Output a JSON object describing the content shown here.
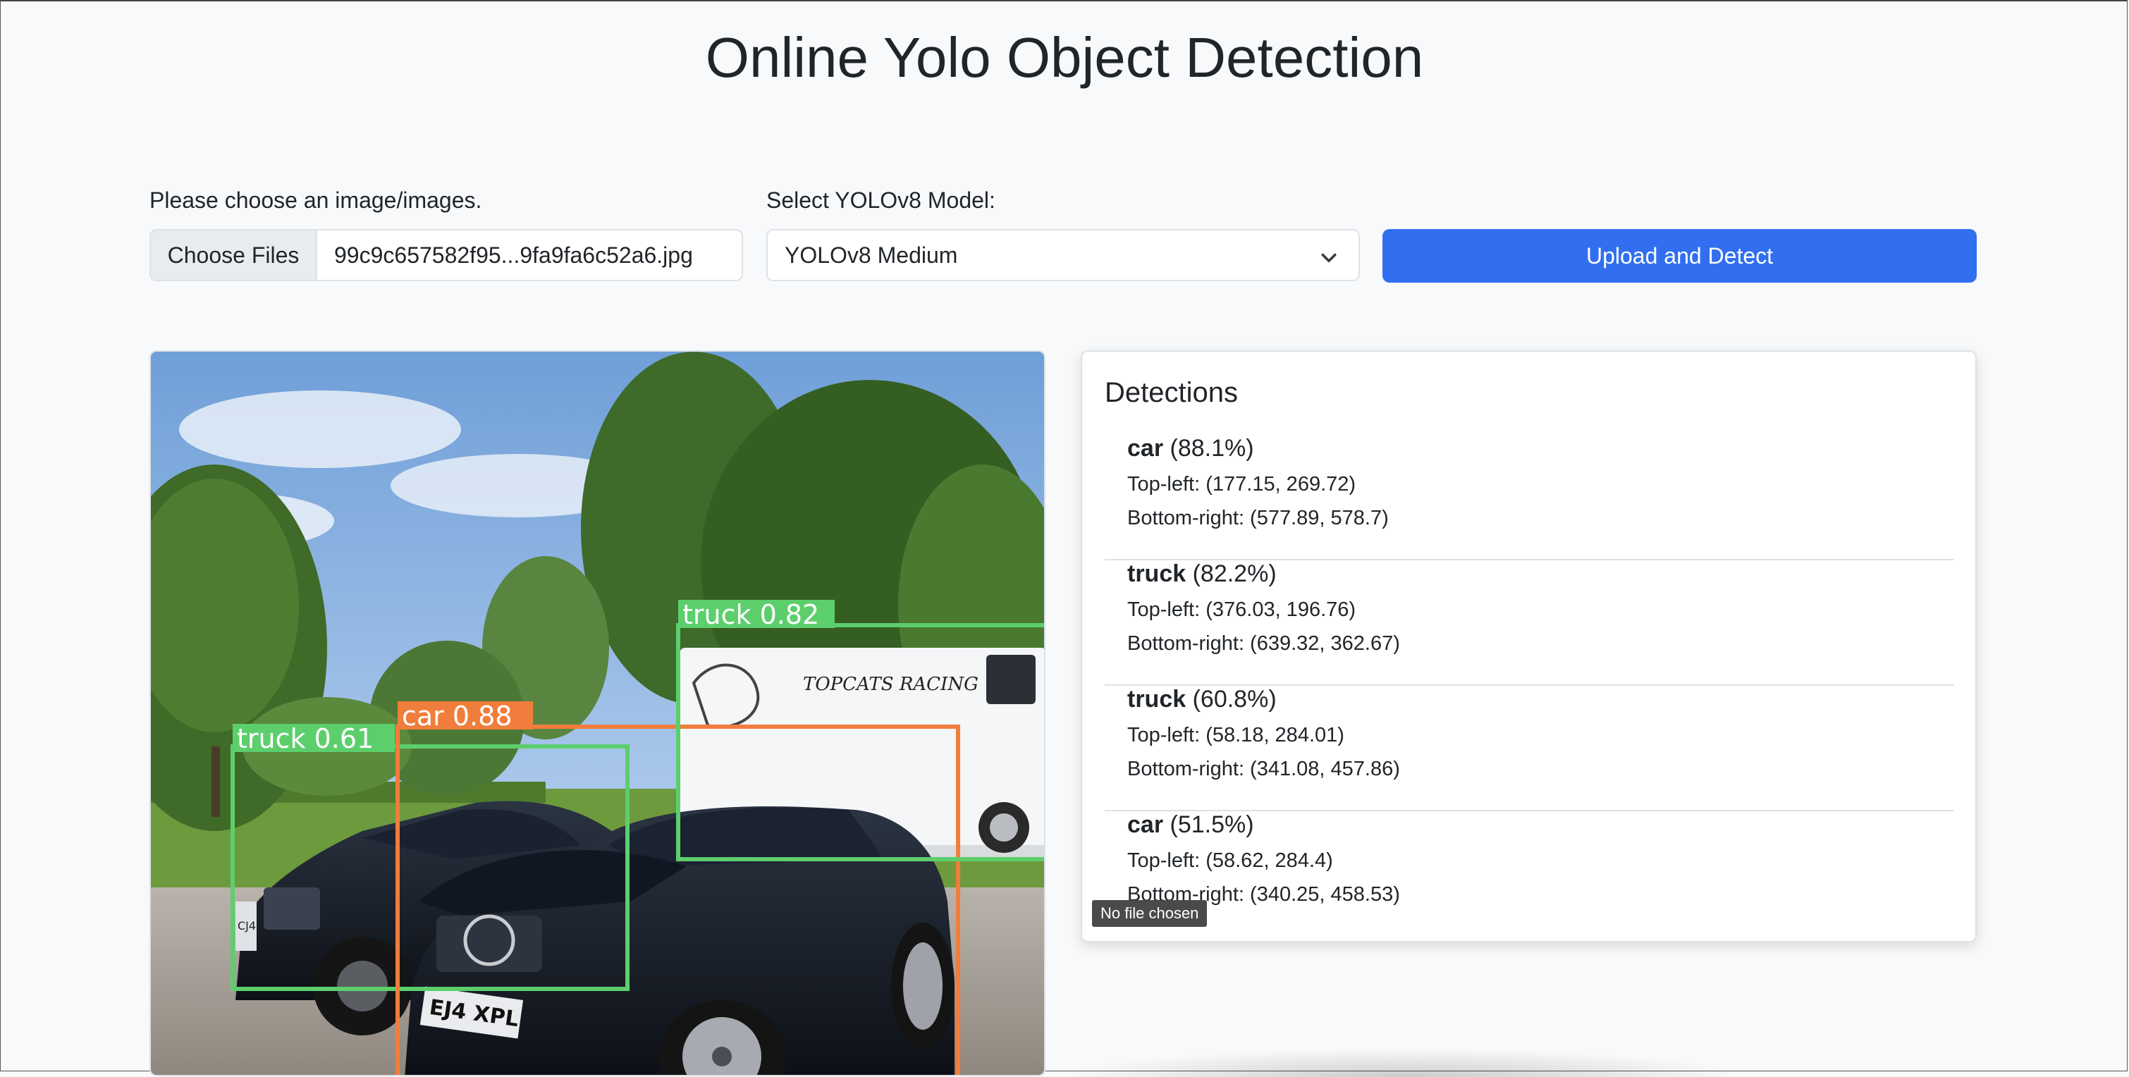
{
  "page": {
    "title": "Online Yolo Object Detection"
  },
  "upload": {
    "label": "Please choose an image/images.",
    "choose_button": "Choose Files",
    "file_name": "99c9c657582f95...9fa9fa6c52a6.jpg",
    "tooltip": "No file chosen"
  },
  "model": {
    "label": "Select YOLOv8 Model:",
    "selected": "YOLOv8 Medium"
  },
  "detect_button": "Upload and Detect",
  "image": {
    "truck_sign": "TOPCATS RACING",
    "plate": "EJ4 XPL",
    "plate_small": "CJ4",
    "boxes": [
      {
        "label": "car 0.88",
        "color": "#f07d3c"
      },
      {
        "label": "truck 0.82",
        "color": "#5ccf6c"
      },
      {
        "label": "truck 0.61",
        "color": "#5ccf6c"
      }
    ]
  },
  "detections": {
    "title": "Detections",
    "items": [
      {
        "name": "car",
        "conf": "(88.1%)",
        "top_left": "Top-left: (177.15, 269.72)",
        "bottom_right": "Bottom-right: (577.89, 578.7)"
      },
      {
        "name": "truck",
        "conf": "(82.2%)",
        "top_left": "Top-left: (376.03, 196.76)",
        "bottom_right": "Bottom-right: (639.32, 362.67)"
      },
      {
        "name": "truck",
        "conf": "(60.8%)",
        "top_left": "Top-left: (58.18, 284.01)",
        "bottom_right": "Bottom-right: (341.08, 457.86)"
      },
      {
        "name": "car",
        "conf": "(51.5%)",
        "top_left": "Top-left: (58.62, 284.4)",
        "bottom_right": "Bottom-right: (340.25, 458.53)"
      }
    ]
  },
  "colors": {
    "primary": "#316ff0",
    "car_box": "#f07d3c",
    "truck_box": "#5ccf6c"
  },
  "icons": {
    "select": "chevron-down-icon"
  }
}
